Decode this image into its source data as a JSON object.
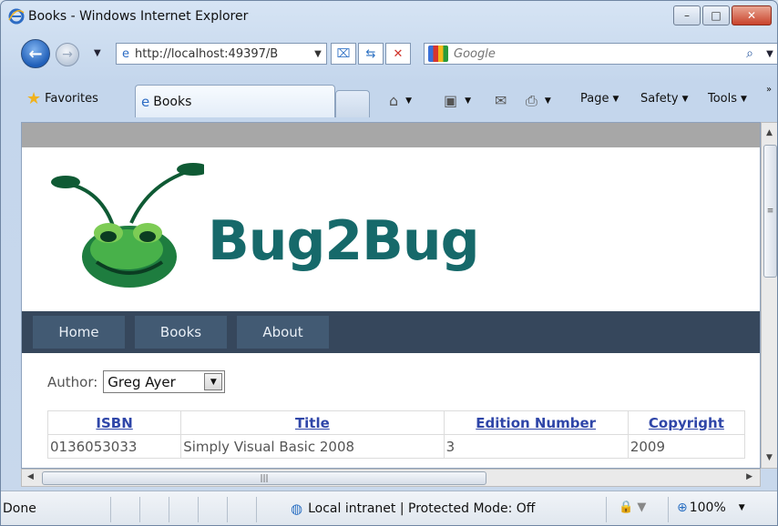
{
  "window": {
    "title": "Books - Windows Internet Explorer",
    "controls": {
      "minimize": "–",
      "maximize": "□",
      "close": "✕"
    }
  },
  "address_bar": {
    "url": "http://localhost:49397/B",
    "search_placeholder": "Google"
  },
  "toolbar": {
    "favorites_label": "Favorites",
    "tab_label": "Books",
    "page_menu": "Page",
    "safety_menu": "Safety",
    "tools_menu": "Tools"
  },
  "site": {
    "brand": "Bug2Bug",
    "nav": [
      {
        "label": "Home"
      },
      {
        "label": "Books"
      },
      {
        "label": "About"
      }
    ]
  },
  "filter": {
    "author_label": "Author:",
    "author_selected": "Greg Ayer"
  },
  "table": {
    "headers": [
      "ISBN",
      "Title",
      "Edition Number",
      "Copyright"
    ],
    "rows": [
      [
        "0136053033",
        "Simply Visual Basic 2008",
        "3",
        "2009"
      ]
    ]
  },
  "status": {
    "text": "Done",
    "zone": "Local intranet | Protected Mode: Off",
    "zoom": "100%"
  },
  "colors": {
    "nav_bg": "#36475c",
    "nav_item_bg": "#425a73",
    "brand_text": "#16696a",
    "link": "#2f46a8"
  }
}
